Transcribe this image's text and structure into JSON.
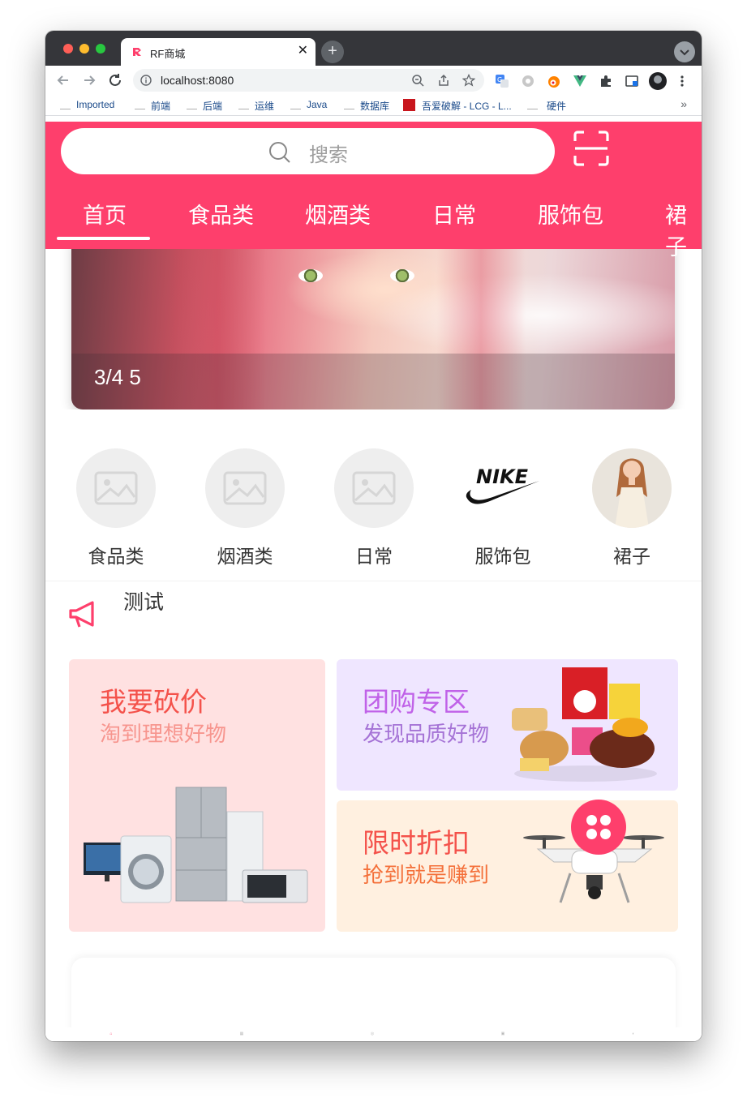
{
  "browser": {
    "tab_title": "RF商城",
    "tab_close": "✕",
    "new_tab": "+",
    "url": "localhost:8080",
    "bookmarks": [
      "Imported",
      "前端",
      "后端",
      "运维",
      "Java",
      "数据库",
      "吾爱破解 - LCG - L...",
      "硬件"
    ],
    "bookmarks_more": "»"
  },
  "header": {
    "search_placeholder": "搜索",
    "category_tabs": [
      "首页",
      "食品类",
      "烟酒类",
      "日常",
      "服饰包",
      "裙子"
    ],
    "active_tab_index": 0,
    "accent_color": "#fe3f6c"
  },
  "banner": {
    "counter": "3/4 5"
  },
  "shortcuts": {
    "items": [
      {
        "label": "食品类",
        "icon": "image-placeholder-icon"
      },
      {
        "label": "烟酒类",
        "icon": "image-placeholder-icon"
      },
      {
        "label": "日常",
        "icon": "image-placeholder-icon"
      },
      {
        "label": "服饰包",
        "icon": "nike-logo"
      },
      {
        "label": "裙子",
        "icon": "model-photo"
      }
    ]
  },
  "notice": {
    "text": "测试",
    "icon": "megaphone-icon"
  },
  "promos": {
    "bargain": {
      "title": "我要砍价",
      "subtitle": "淘到理想好物",
      "bg": "#ffe1e1",
      "title_color": "#f4524b",
      "sub_color": "#f7958e"
    },
    "group": {
      "title": "团购专区",
      "subtitle": "发现品质好物",
      "bg": "#efe6ff",
      "title_color": "#c062e8",
      "sub_color": "#a573d6"
    },
    "discount": {
      "title": "限时折扣",
      "subtitle": "抢到就是赚到",
      "bg": "#fff0e0",
      "title_color": "#f4524b",
      "sub_color": "#f4703a"
    }
  },
  "fab": {
    "icon": "four-petal-menu-icon"
  },
  "bottom_nav": {
    "items": [
      "home-icon",
      "category-icon",
      "discover-icon",
      "cart-icon",
      "user-icon"
    ]
  }
}
